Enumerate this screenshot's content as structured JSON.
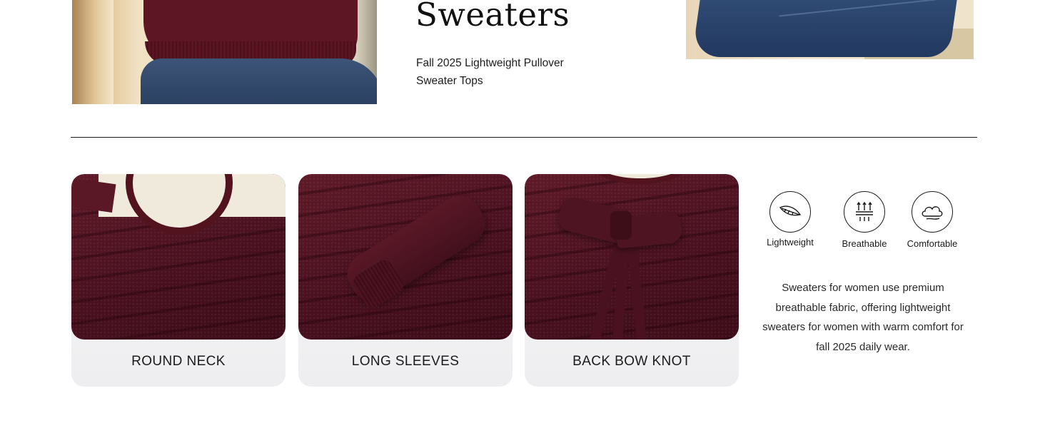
{
  "hero": {
    "title": "Sweaters",
    "subtitle_line1": "Fall 2025 Lightweight Pullover",
    "subtitle_line2": "Sweater Tops"
  },
  "cards": [
    {
      "label": "ROUND NECK"
    },
    {
      "label": "LONG SLEEVES"
    },
    {
      "label": "BACK BOW KNOT"
    }
  ],
  "features": [
    {
      "icon": "feather-icon",
      "label": "Lightweight"
    },
    {
      "icon": "airflow-icon",
      "label": "Breathable"
    },
    {
      "icon": "cloud-icon",
      "label": "Comfortable"
    }
  ],
  "description": "Sweaters for women use premium breathable fabric, offering lightweight sweaters for women with warm comfort for fall 2025 daily wear.",
  "colors": {
    "sweater": "#5a1624",
    "card_bg": "#f2f2f4",
    "text": "#1a1a1a"
  }
}
